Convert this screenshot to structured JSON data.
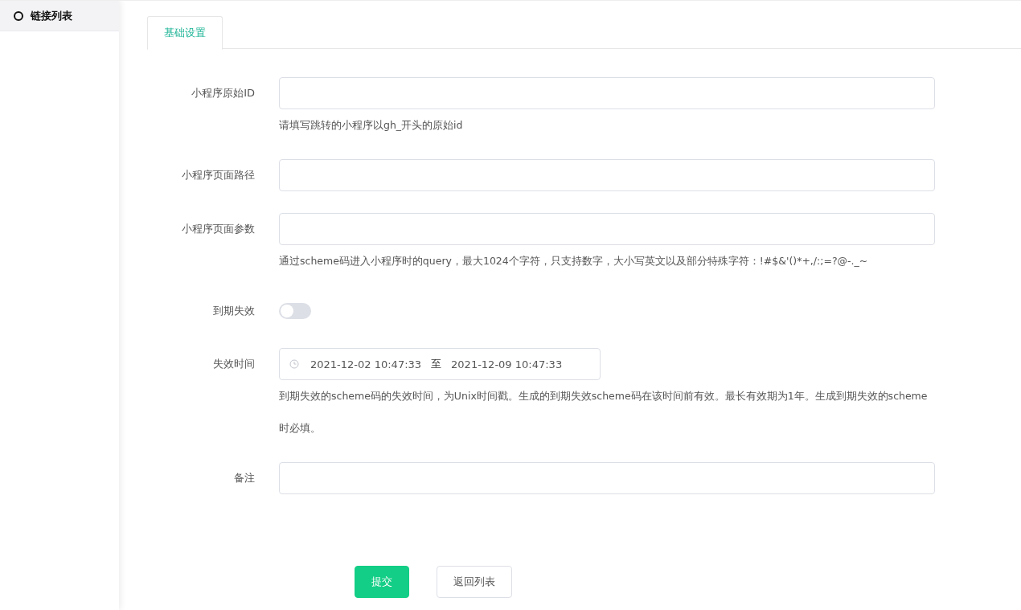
{
  "sidebar": {
    "items": [
      {
        "label": "链接列表",
        "selected": true
      }
    ]
  },
  "tabs": [
    {
      "label": "基础设置",
      "selected": true
    }
  ],
  "form": {
    "fields": [
      {
        "kind": "text",
        "label": "小程序原始ID",
        "hint": "请填写跳转的小程序以gh_开头的原始id"
      },
      {
        "kind": "text",
        "label": "小程序页面路径"
      },
      {
        "kind": "text",
        "label": "小程序页面参数",
        "hint": "通过scheme码进入小程序时的query，最大1024个字符，只支持数字，大小写英文以及部分特殊字符：!#$&'()*+,/:;=?@-._~"
      },
      {
        "kind": "switch",
        "label": "到期失效",
        "on": false
      },
      {
        "kind": "daterange",
        "label": "失效时间",
        "start": "2021-12-02 10:47:33",
        "separator": "至",
        "end": "2021-12-09 10:47:33",
        "hint": "到期失效的scheme码的失效时间，为Unix时间戳。生成的到期失效scheme码在该时间前有效。最长有效期为1年。生成到期失效的scheme时必填。"
      },
      {
        "kind": "text",
        "label": "备注"
      }
    ]
  },
  "buttons": [
    {
      "label": "提交",
      "kind": "primary"
    },
    {
      "label": "返回列表",
      "kind": "default"
    }
  ]
}
